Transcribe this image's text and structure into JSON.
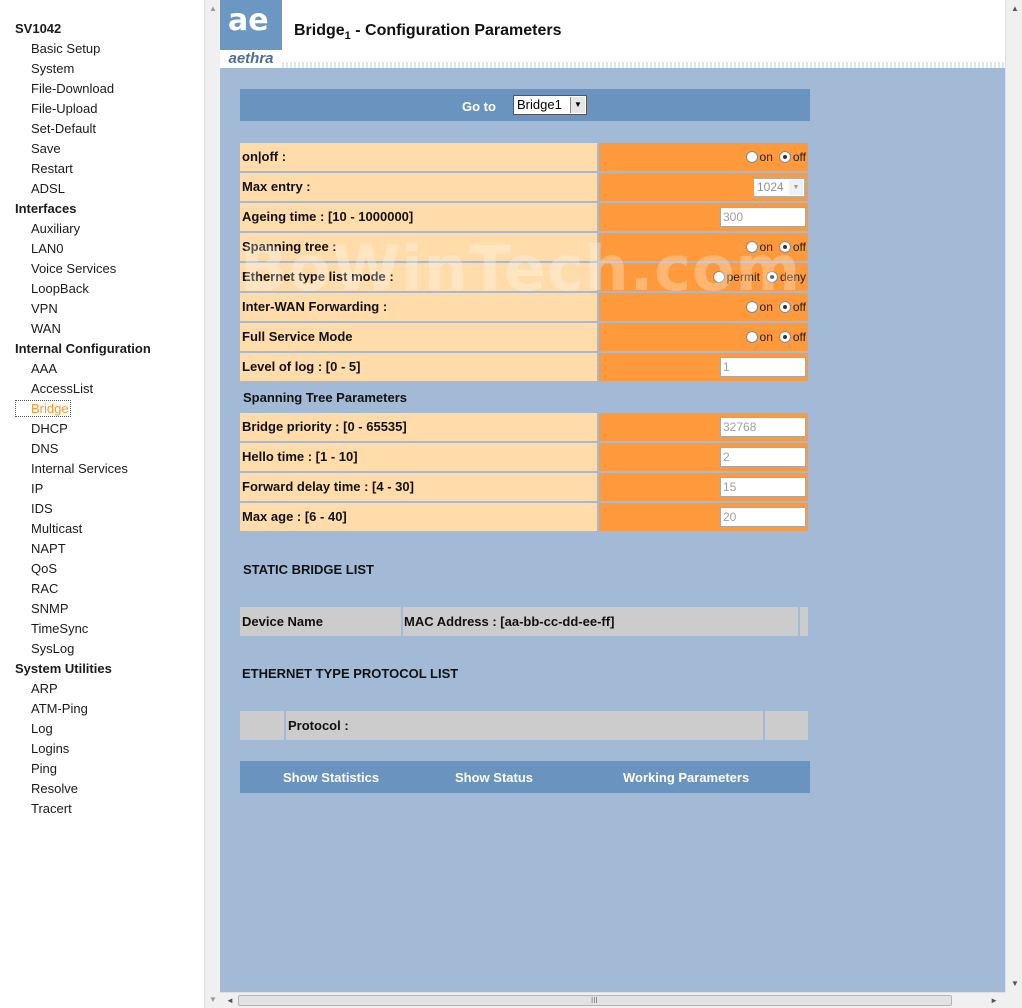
{
  "nav": {
    "groups": [
      {
        "title": "SV1042",
        "items": [
          "Basic Setup",
          "System",
          "File-Download",
          "File-Upload",
          "Set-Default",
          "Save",
          "Restart",
          "ADSL"
        ]
      },
      {
        "title": "Interfaces",
        "items": [
          "Auxiliary",
          "LAN0",
          "Voice Services",
          "LoopBack",
          "VPN",
          "WAN"
        ]
      },
      {
        "title": "Internal Configuration",
        "items": [
          "AAA",
          "AccessList",
          "Bridge",
          "DHCP",
          "DNS",
          "Internal Services",
          "IP",
          "IDS",
          "Multicast",
          "NAPT",
          "QoS",
          "RAC",
          "SNMP",
          "TimeSync",
          "SysLog"
        ]
      },
      {
        "title": "System Utilities",
        "items": [
          "ARP",
          "ATM-Ping",
          "Log",
          "Logins",
          "Ping",
          "Resolve",
          "Tracert"
        ]
      }
    ],
    "active_item": "Bridge"
  },
  "header": {
    "logo_glyph": "ae",
    "logo_text": "aethra",
    "title_prefix": "Bridge",
    "title_sub": "1",
    "title_suffix": " - Configuration Parameters"
  },
  "goto": {
    "label": "Go to",
    "selected": "Bridge1"
  },
  "config_rows": [
    {
      "label": "on|off :",
      "type": "radio",
      "options": [
        "on",
        "off"
      ],
      "checked": "off"
    },
    {
      "label": "Max entry :",
      "type": "select",
      "value": "1024"
    },
    {
      "label": "Ageing time : [10 - 1000000]",
      "type": "text",
      "value": "300"
    },
    {
      "label": "Spanning tree :",
      "type": "radio",
      "options": [
        "on",
        "off"
      ],
      "checked": "off"
    },
    {
      "label": "Ethernet type list mode :",
      "type": "radio",
      "options": [
        "permit",
        "deny"
      ],
      "checked": "deny"
    },
    {
      "label": "Inter-WAN Forwarding :",
      "type": "radio",
      "options": [
        "on",
        "off"
      ],
      "checked": "off"
    },
    {
      "label": "Full Service Mode",
      "type": "radio",
      "options": [
        "on",
        "off"
      ],
      "checked": "off"
    },
    {
      "label": "Level of log : [0 - 5]",
      "type": "text",
      "value": "1"
    }
  ],
  "spanning_section_title": "Spanning Tree Parameters",
  "spanning_rows": [
    {
      "label": "Bridge priority : [0 - 65535]",
      "type": "text",
      "value": "32768"
    },
    {
      "label": "Hello time : [1 - 10]",
      "type": "text",
      "value": "2"
    },
    {
      "label": "Forward delay time : [4 - 30]",
      "type": "text",
      "value": "15"
    },
    {
      "label": "Max age : [6 - 40]",
      "type": "text",
      "value": "20"
    }
  ],
  "static_bridge": {
    "title": "STATIC BRIDGE LIST",
    "col_device": "Device Name",
    "col_mac": "MAC Address : [aa-bb-cc-dd-ee-ff]"
  },
  "ethernet_list": {
    "title": "ETHERNET TYPE PROTOCOL LIST",
    "col_protocol": "Protocol :"
  },
  "bottom_links": [
    "Show Statistics",
    "Show Status",
    "Working Parameters"
  ],
  "watermark": "BoWinTech.com",
  "icons": {
    "scroll_up": "▲",
    "scroll_down": "▼",
    "scroll_left": "◄",
    "scroll_right": "►",
    "dropdown": "▼",
    "grip": "III"
  },
  "colors": {
    "page_bg": "#a2bad6",
    "bar_blue": "#6a93c0",
    "label_bg": "#ffdca9",
    "value_bg": "#ff9a3c",
    "grid_bg": "#cccccc",
    "active_nav": "#f39a33"
  }
}
